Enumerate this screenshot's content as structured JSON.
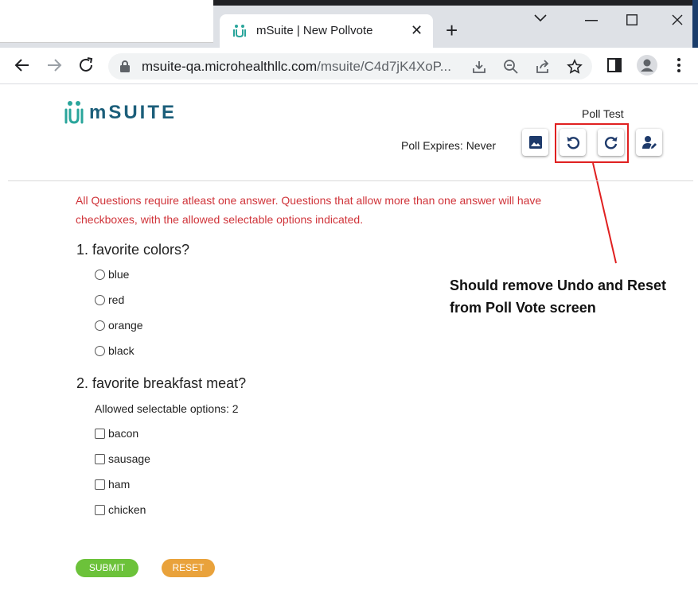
{
  "browser": {
    "tab_title": "mSuite | New Pollvote",
    "tab_close": "✕",
    "new_tab": "+",
    "url_host": "msuite-qa.microhealthllc.com",
    "url_rest": "/msuite/C4d7jK4XoP..."
  },
  "app": {
    "logo_text": "mSUITE",
    "poll_title": "Poll Test",
    "expires": "Poll Expires: Never",
    "notice": "All Questions require atleast one answer. Questions that allow more than one answer will have checkboxes, with the allowed selectable options indicated.",
    "questions": [
      {
        "title": "1. favorite colors?",
        "options": [
          "blue",
          "red",
          "orange",
          "black"
        ]
      },
      {
        "title": "2. favorite breakfast meat?",
        "allowed": "Allowed selectable options: 2",
        "options": [
          "bacon",
          "sausage",
          "ham",
          "chicken"
        ]
      }
    ],
    "submit_label": "SUBMIT",
    "reset_label": "RESET"
  },
  "annotation": {
    "line1": "Should remove Undo and Reset",
    "line2": "from Poll Vote screen"
  },
  "colors": {
    "brand": "#1b5e7a",
    "notice": "#d0343a",
    "submit": "#6cc23a",
    "reset": "#e9a23b",
    "annotation": "#e02020"
  }
}
